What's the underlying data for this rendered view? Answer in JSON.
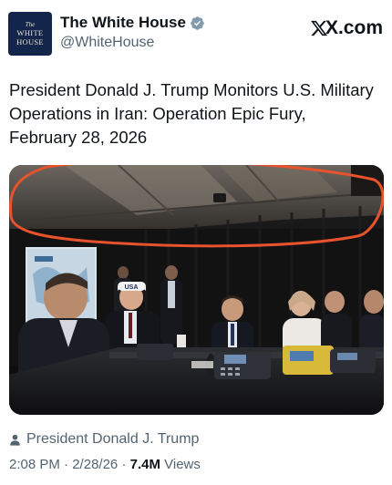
{
  "account": {
    "avatar_line1": "The",
    "avatar_line2": "WHITE",
    "avatar_line3": "HOUSE",
    "display_name": "The White House",
    "handle": "@WhiteHouse",
    "verified_badge_color": "#829aab"
  },
  "brand": {
    "label": "X.com",
    "logo_icon": "x-logo-icon"
  },
  "tweet": {
    "text": "President Donald J. Trump Monitors U.S. Military Operations in Iran: Operation Epic Fury, February 28, 2026"
  },
  "media": {
    "cap_text": "USA",
    "annotation_color": "#e8522c"
  },
  "footer": {
    "author_icon": "person-icon",
    "author": "President Donald J. Trump",
    "time": "2:08 PM",
    "separator1": "·",
    "date": "2/28/26",
    "separator2": "·",
    "views_count": "7.4M",
    "views_label": "Views"
  },
  "colors": {
    "text_primary": "#0f1419",
    "text_secondary": "#536471"
  }
}
